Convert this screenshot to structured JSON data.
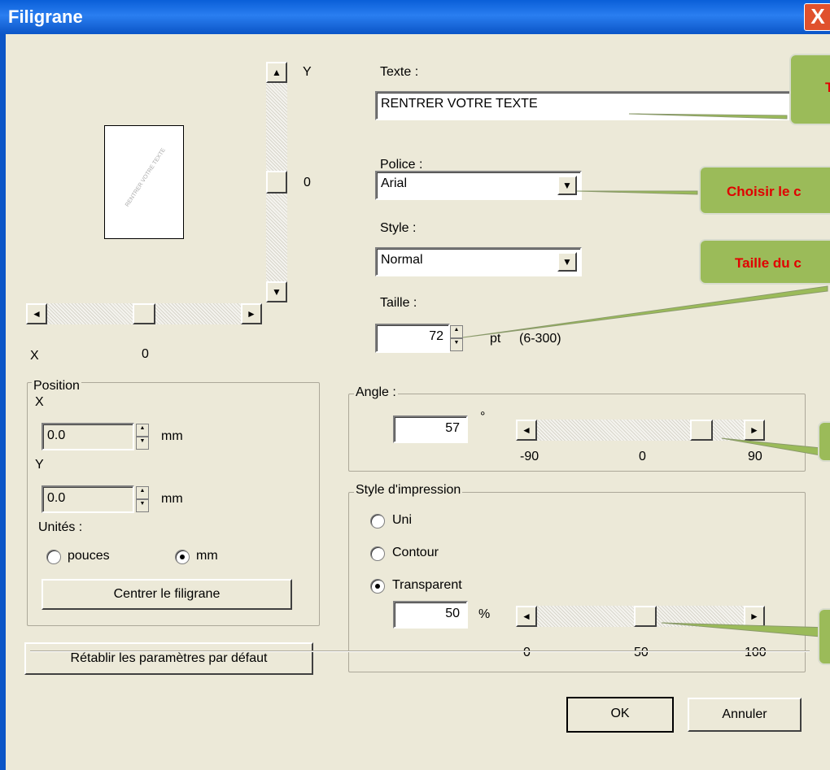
{
  "window": {
    "title": "Filigrane",
    "close_label": "X"
  },
  "preview": {
    "sample_text": "RENTRER VOTRE TEXTE"
  },
  "vertical_slider": {
    "axis_label": "Y",
    "value_label": "0",
    "up": "▲",
    "down": "▼"
  },
  "horizontal_slider": {
    "axis_label": "X",
    "value_label": "0",
    "left": "◄",
    "right": "►"
  },
  "text_field": {
    "label": "Texte :",
    "value": "RENTRER VOTRE TEXTE"
  },
  "font_field": {
    "label": "Police :",
    "value": "Arial",
    "arrow": "▼"
  },
  "style_field": {
    "label": "Style :",
    "value": "Normal",
    "arrow": "▼"
  },
  "size_field": {
    "label": "Taille :",
    "value": "72",
    "unit": "pt",
    "range": "(6-300)"
  },
  "angle_group": {
    "label": "Angle :",
    "value": "57",
    "degree": "°",
    "min": "-90",
    "mid": "0",
    "max": "90",
    "slider_fraction": 0.817
  },
  "print_style_group": {
    "label": "Style d'impression",
    "options": [
      "Uni",
      "Contour",
      "Transparent"
    ],
    "selected": "Transparent",
    "transparency_value": "50",
    "percent": "%",
    "min": "0",
    "mid": "50",
    "max": "100",
    "slider_fraction": 0.5
  },
  "position_group": {
    "label": "Position",
    "x_label": "X",
    "x_value": "0.0",
    "y_label": "Y",
    "y_value": "0.0",
    "unit": "mm",
    "units_label": "Unités :",
    "unit_options": [
      "pouces",
      "mm"
    ],
    "selected_unit": "mm",
    "center_button": "Centrer le filigrane"
  },
  "reset_button": "Rétablir les paramètres par défaut",
  "ok_button": "OK",
  "cancel_button": "Annuler",
  "callouts": {
    "text_callout": "T",
    "font_callout": "Choisir le c",
    "size_callout": "Taille du c"
  },
  "colors": {
    "titlebar": "#0a5fd8",
    "dialog_bg": "#ece9d8",
    "callout_bg": "#9bbb59",
    "callout_text": "#e00000"
  }
}
